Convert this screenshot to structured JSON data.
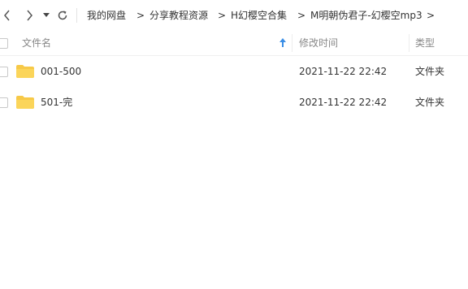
{
  "breadcrumb": {
    "items": [
      "我的网盘",
      "分享教程资源",
      "H幻樱空合集",
      "M明朝伪君子-幻樱空mp3"
    ],
    "separator": ">"
  },
  "columns": {
    "name": "文件名",
    "modified": "修改时间",
    "type": "类型"
  },
  "files": [
    {
      "name": "001-500",
      "modified": "2021-11-22 22:42",
      "type": "文件夹"
    },
    {
      "name": "501-完",
      "modified": "2021-11-22 22:42",
      "type": "文件夹"
    }
  ],
  "colors": {
    "folder": "#f7c948",
    "sort_arrow": "#3a8ee6",
    "header_text": "#888888"
  },
  "icons": {
    "back": "chevron-left-icon",
    "forward": "chevron-right-icon",
    "history": "caret-down-icon",
    "refresh": "refresh-icon",
    "folder": "folder-icon",
    "sort": "sort-up-icon"
  }
}
